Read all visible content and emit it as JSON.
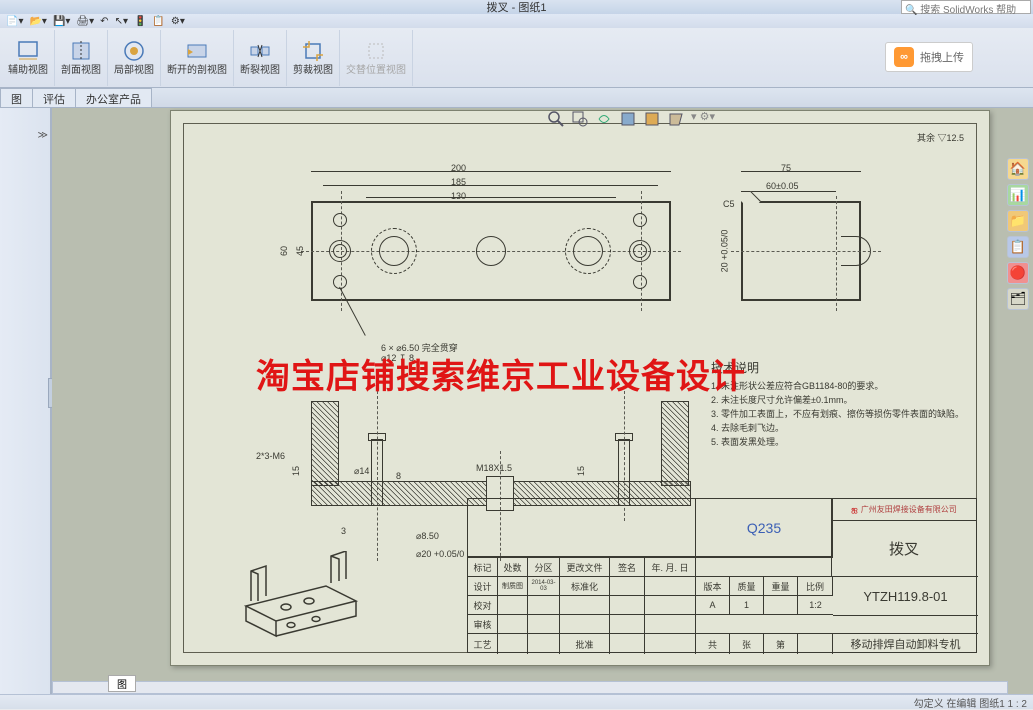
{
  "title": "拨叉 - 图纸1",
  "search_placeholder": "搜索 SolidWorks 帮助",
  "ribbon": [
    {
      "label": "辅助视图"
    },
    {
      "label": "剖面视图"
    },
    {
      "label": "局部视图"
    },
    {
      "label": "断开的剖视图"
    },
    {
      "label": "断裂视图"
    },
    {
      "label": "剪裁视图"
    },
    {
      "label": "交替位置视图"
    }
  ],
  "cloud": "拖拽上传",
  "tabs": [
    "图",
    "评估",
    "办公室产品"
  ],
  "right_tools": [
    "🏠",
    "📊",
    "📁",
    "📋",
    "🔴",
    "🗂"
  ],
  "dims": {
    "d200": "200",
    "d185": "185",
    "d130": "130",
    "d60": "60",
    "d45": "45",
    "d75": "75",
    "d60tol": "60±0.05",
    "c5": "C5",
    "dh": "20 +0.05/0",
    "holes_note": "6 × ⌀6.50 完全贯穿",
    "holes_cb": "⌀12 ↧ 8",
    "thread": "2*3-M6",
    "d15": "15",
    "d14": "⌀14",
    "d8": "8",
    "m18": "M18X1.5",
    "d15b": "15",
    "d3": "3",
    "d850": "⌀8.50",
    "d20tol": "⌀20 +0.05/0",
    "surf": "12.5",
    "surf_pre": "其余"
  },
  "notes_header": "技术说明",
  "notes": [
    "1. 未注形状公差应符合GB1184-80的要求。",
    "2. 未注长度尺寸允许偏差±0.1mm。",
    "3. 零件加工表面上，不应有划痕、擦伤等损伤零件表面的缺陷。",
    "4. 去除毛刺飞边。",
    "5. 表面发黑处理。"
  ],
  "watermark": "淘宝店铺搜索维京工业设备设计",
  "tb": {
    "material": "Q235",
    "company": "广州友田焊接设备有限公司",
    "part_name": "拨叉",
    "part_no": "YTZH119.8-01",
    "project": "移动排焊自动卸料专机",
    "scale": "1:2",
    "ver": "A",
    "qty": "1",
    "h_mark": "标记",
    "h_loc": "处数",
    "h_zone": "分区",
    "h_file": "更改文件",
    "h_sig": "签名",
    "h_date": "年. 月. 日",
    "h_design": "设计",
    "h_dval": "制质图",
    "h_ddate": "2014-03-03",
    "h_std": "标准化",
    "h_rev": "版本",
    "h_mass": "质量",
    "h_sht": "重量",
    "h_scale": "比例",
    "h_chk": "校对",
    "h_app": "审核",
    "h_proc": "工艺",
    "h_appr": "批准",
    "h_tot": "共",
    "h_pg": "张",
    "h_cur": "第"
  },
  "status": "勾定义   在编辑 图纸1  1 : 2",
  "doc_tab": "图"
}
